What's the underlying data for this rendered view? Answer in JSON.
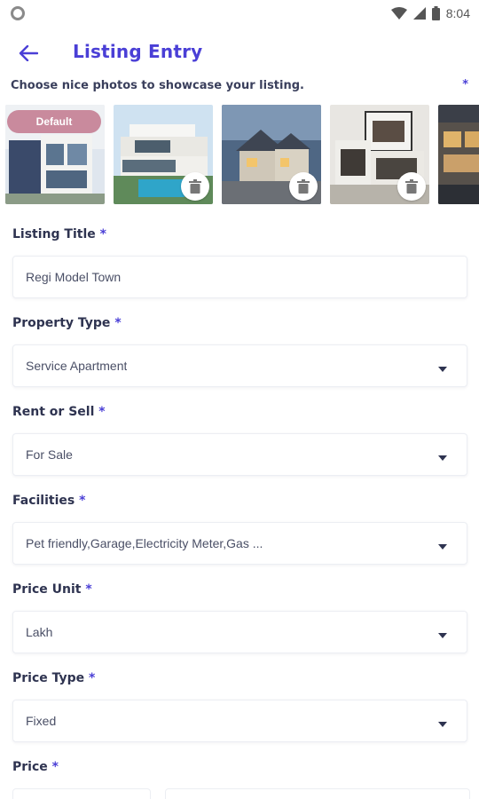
{
  "status_bar": {
    "time": "8:04"
  },
  "header": {
    "title": "Listing Entry"
  },
  "photos": {
    "hint": "Choose nice photos to showcase your listing.",
    "required_marker": "*",
    "default_label": "Default"
  },
  "form": {
    "listing_title": {
      "label": "Listing Title",
      "req": "*",
      "value": "Regi Model Town"
    },
    "property_type": {
      "label": "Property Type",
      "req": "*",
      "value": "Service Apartment"
    },
    "rent_or_sell": {
      "label": "Rent or Sell",
      "req": "*",
      "value": "For Sale"
    },
    "facilities": {
      "label": "Facilities",
      "req": "*",
      "value": "Pet friendly,Garage,Electricity Meter,Gas ..."
    },
    "price_unit": {
      "label": "Price Unit",
      "req": "*",
      "value": "Lakh"
    },
    "price_type": {
      "label": "Price Type",
      "req": "*",
      "value": "Fixed"
    },
    "price": {
      "label": "Price",
      "req": "*"
    }
  },
  "colors": {
    "accent": "#4a3fd6",
    "badge": "#c98a9d"
  }
}
